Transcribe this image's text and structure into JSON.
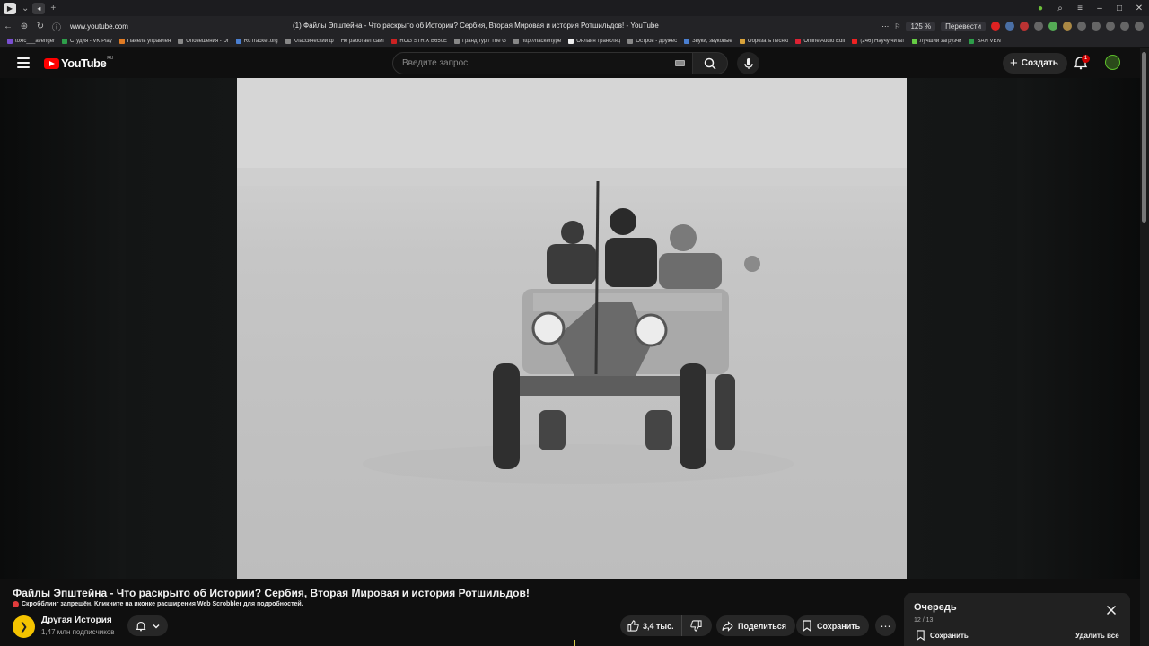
{
  "browser": {
    "url": "www.youtube.com",
    "tab_title": "(1) Файлы Эпштейна - Что раскрыто об Истории? Сербия, Вторая Мировая и история Ротшильдов! - YouTube",
    "zoom": "125 %",
    "translate_label": "Перевести",
    "bookmarks": [
      "toxic___avenger",
      "Студия - VK Play",
      "Панель управлен",
      "Оповещения - Dr",
      "RuTracker.org",
      "Классический ф",
      "Не работает сайт",
      "ROG STRIX B650E",
      "Гранд тур / The G",
      "http://hackertype",
      "Онлайн трансляц",
      "Остров - дружес",
      "Звуки, звуковые",
      "Обрезать песню",
      "Online Audio Edit",
      "(246) Научу читат",
      "Лучший загрузчи",
      "SAN VEN"
    ]
  },
  "header": {
    "logo_text": "YouTube",
    "logo_region": "RU",
    "search_placeholder": "Введите запрос",
    "create_label": "Создать",
    "notification_count": "1"
  },
  "video": {
    "title": "Файлы Эпштейна - Что раскрыто об Истории? Сербия, Вторая Мировая и история Ротшильдов!",
    "scrobble_notice": "Скробблинг запрещён. Кликните на иконке расширения Web Scrobbler для подробностей.",
    "channel_name": "Другая История",
    "subscribers": "1,47 млн подписчиков",
    "likes": "3,4 тыс.",
    "share_label": "Поделиться",
    "save_label": "Сохранить"
  },
  "queue": {
    "title": "Очередь",
    "count": "12 / 13",
    "save_label": "Сохранить",
    "clear_label": "Удалить все"
  },
  "colors": {
    "background": "#0f0f0f",
    "brand_red": "#ff0000",
    "pill_bg": "#272727",
    "channel_avatar": "#f5c400"
  }
}
